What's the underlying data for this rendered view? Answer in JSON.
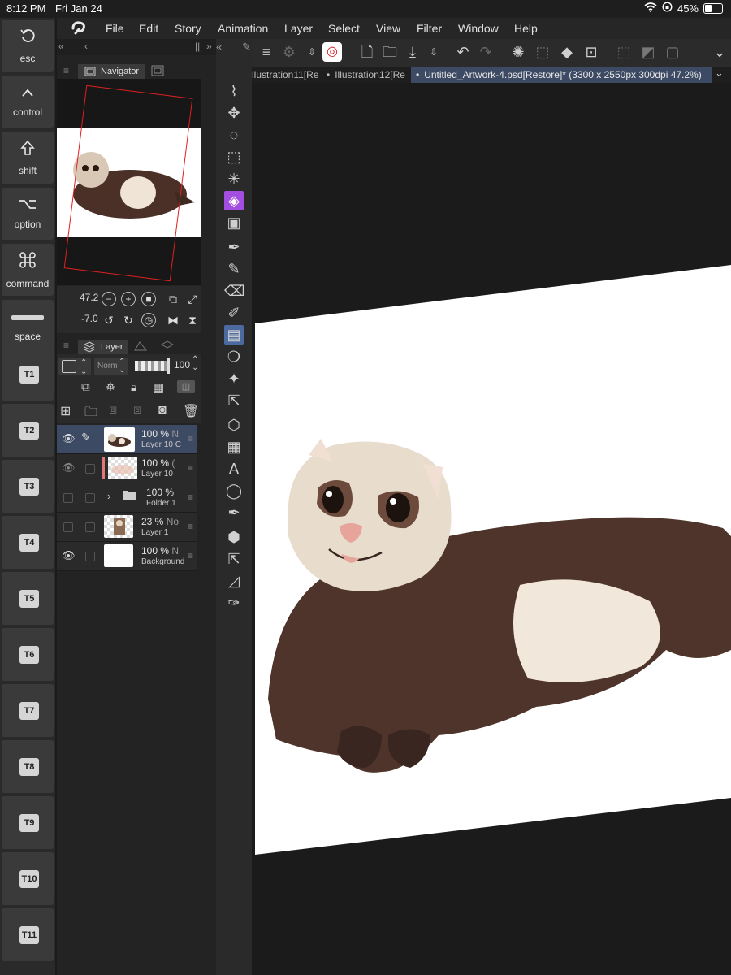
{
  "status_bar": {
    "time": "8:12 PM",
    "date": "Fri Jan 24",
    "battery": "45%",
    "battery_level": 0.45
  },
  "menu": {
    "app_icon": "clip-studio-icon",
    "items": [
      "File",
      "Edit",
      "Story",
      "Animation",
      "Layer",
      "Select",
      "View",
      "Filter",
      "Window",
      "Help"
    ]
  },
  "modifiers": [
    {
      "label": "esc",
      "icon": "undo-arrow"
    },
    {
      "label": "control",
      "icon": "caret-up"
    },
    {
      "label": "shift",
      "icon": "shift-arrow"
    },
    {
      "label": "option",
      "icon": "option-key"
    },
    {
      "label": "command",
      "icon": "command-key"
    },
    {
      "label": "space",
      "icon": "space-bar"
    }
  ],
  "tool_keys": [
    "T1",
    "T2",
    "T3",
    "T4",
    "T5",
    "T6",
    "T7",
    "T8",
    "T9",
    "T10",
    "T11"
  ],
  "tabs": [
    {
      "label": "llustration11[Re"
    },
    {
      "label": "Illustration12[Re"
    },
    {
      "label": "Untitled_Artwork-4.psd[Restore]* (3300 x 2550px 300dpi 47.2%)",
      "active": true
    }
  ],
  "navigator": {
    "title": "Navigator",
    "zoom": "47.2",
    "rotation": "-7.0"
  },
  "layer_panel": {
    "title": "Layer",
    "blend_mode": "Norm",
    "opacity": "100"
  },
  "layers": [
    {
      "pct": "100 %",
      "blend": "N",
      "name": "Layer 10 C",
      "visible": true,
      "selected": true,
      "editing": true,
      "thumb": "ferret"
    },
    {
      "pct": "100 %",
      "blend": "(",
      "name": "Layer 10",
      "visible": true,
      "selected": false,
      "thumb": "sketch"
    },
    {
      "pct": "100 %",
      "blend": "",
      "name": "Folder 1",
      "visible": false,
      "selected": false,
      "folder": true
    },
    {
      "pct": "23 %",
      "blend": "No",
      "name": "Layer 1",
      "visible": false,
      "selected": false,
      "thumb": "photo"
    },
    {
      "pct": "100 %",
      "blend": "N",
      "name": "Background",
      "visible": true,
      "selected": false,
      "thumb": "white"
    }
  ],
  "accent_color": "#a24ee0",
  "selection_color": "#3d4a64"
}
